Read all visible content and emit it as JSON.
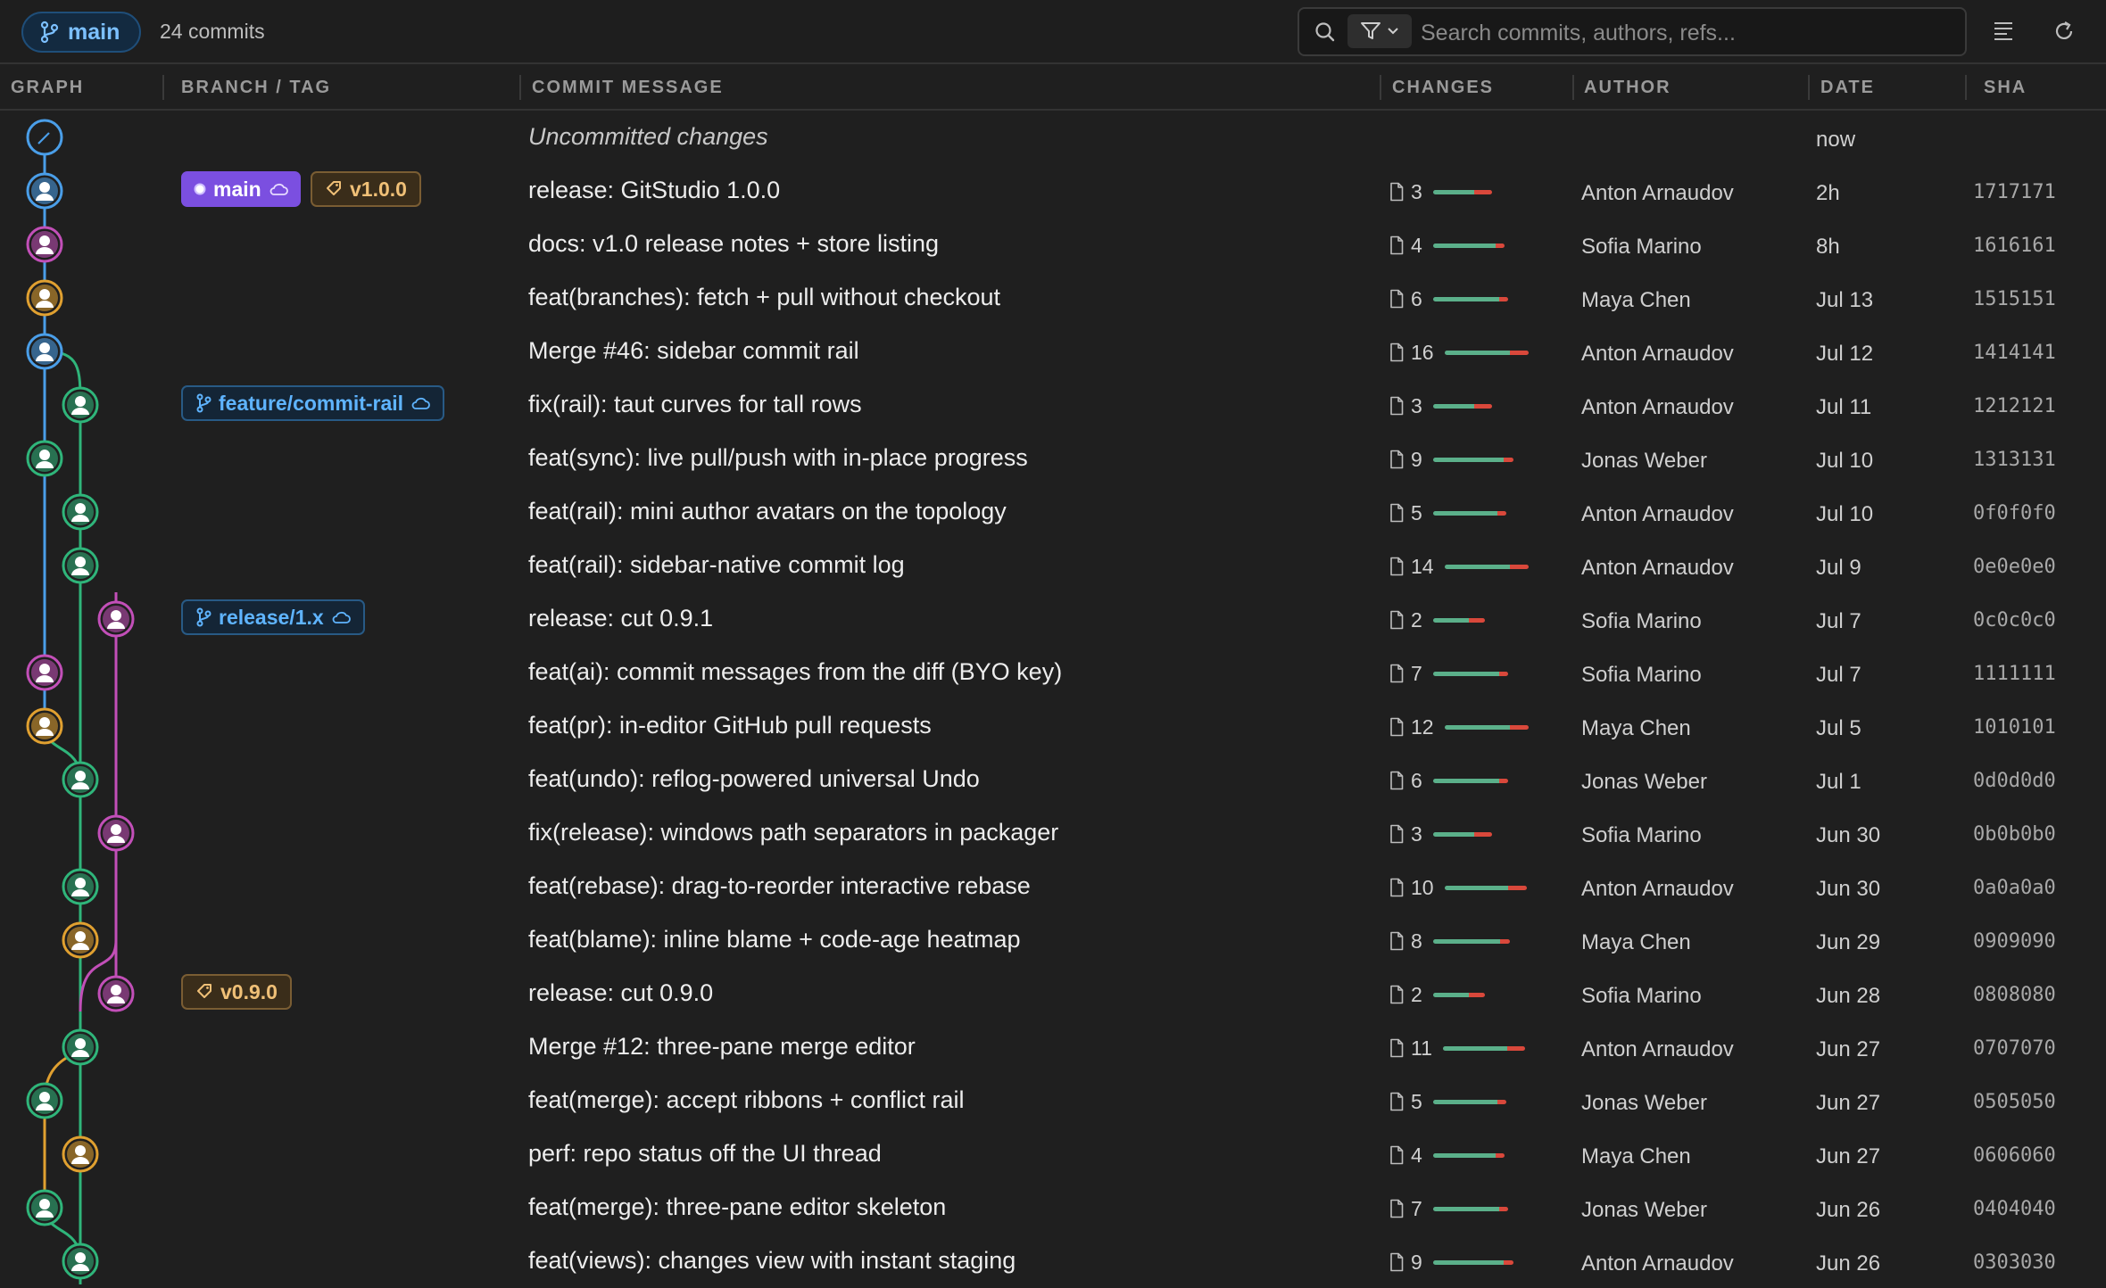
{
  "toolbar": {
    "branch": "main",
    "commit_count": "24 commits",
    "search_placeholder": "Search commits, authors, refs..."
  },
  "columns": {
    "graph": "GRAPH",
    "refs": "BRANCH / TAG",
    "message": "COMMIT MESSAGE",
    "changes": "CHANGES",
    "author": "AUTHOR",
    "date": "DATE",
    "sha": "SHA"
  },
  "colors": {
    "lane_main": "#4a9ee8",
    "lane_feature": "#2fb57a",
    "lane_release": "#c24fb8",
    "lane_merge": "#e0a030",
    "head_badge": "#7b4fe0",
    "bar_add": "#5bb08a",
    "bar_del": "#d9483b"
  },
  "commits": [
    {
      "message": "Uncommitted changes",
      "uncommitted": true,
      "changes": "",
      "author": "",
      "date": "now",
      "sha": ""
    },
    {
      "message": "release: GitStudio 1.0.0",
      "changes": "3",
      "author": "Anton Arnaudov",
      "date": "2h",
      "sha": "1717171",
      "refs": [
        {
          "type": "head",
          "label": "main"
        },
        {
          "type": "tag",
          "label": "v1.0.0"
        }
      ]
    },
    {
      "message": "docs: v1.0 release notes + store listing",
      "changes": "4",
      "author": "Sofia Marino",
      "date": "8h",
      "sha": "1616161"
    },
    {
      "message": "feat(branches): fetch + pull without checkout",
      "changes": "6",
      "author": "Maya Chen",
      "date": "Jul 13",
      "sha": "1515151"
    },
    {
      "message": "Merge #46: sidebar commit rail",
      "changes": "16",
      "author": "Anton Arnaudov",
      "date": "Jul 12",
      "sha": "1414141"
    },
    {
      "message": "fix(rail): taut curves for tall rows",
      "changes": "3",
      "author": "Anton Arnaudov",
      "date": "Jul 11",
      "sha": "1212121",
      "refs": [
        {
          "type": "branch",
          "label": "feature/commit-rail"
        }
      ]
    },
    {
      "message": "feat(sync): live pull/push with in-place progress",
      "changes": "9",
      "author": "Jonas Weber",
      "date": "Jul 10",
      "sha": "1313131"
    },
    {
      "message": "feat(rail): mini author avatars on the topology",
      "changes": "5",
      "author": "Anton Arnaudov",
      "date": "Jul 10",
      "sha": "0f0f0f0"
    },
    {
      "message": "feat(rail): sidebar-native commit log",
      "changes": "14",
      "author": "Anton Arnaudov",
      "date": "Jul 9",
      "sha": "0e0e0e0"
    },
    {
      "message": "release: cut 0.9.1",
      "changes": "2",
      "author": "Sofia Marino",
      "date": "Jul 7",
      "sha": "0c0c0c0",
      "refs": [
        {
          "type": "branch",
          "label": "release/1.x"
        }
      ]
    },
    {
      "message": "feat(ai): commit messages from the diff (BYO key)",
      "changes": "7",
      "author": "Sofia Marino",
      "date": "Jul 7",
      "sha": "1111111"
    },
    {
      "message": "feat(pr): in-editor GitHub pull requests",
      "changes": "12",
      "author": "Maya Chen",
      "date": "Jul 5",
      "sha": "1010101"
    },
    {
      "message": "feat(undo): reflog-powered universal Undo",
      "changes": "6",
      "author": "Jonas Weber",
      "date": "Jul 1",
      "sha": "0d0d0d0"
    },
    {
      "message": "fix(release): windows path separators in packager",
      "changes": "3",
      "author": "Sofia Marino",
      "date": "Jun 30",
      "sha": "0b0b0b0"
    },
    {
      "message": "feat(rebase): drag-to-reorder interactive rebase",
      "changes": "10",
      "author": "Anton Arnaudov",
      "date": "Jun 30",
      "sha": "0a0a0a0"
    },
    {
      "message": "feat(blame): inline blame + code-age heatmap",
      "changes": "8",
      "author": "Maya Chen",
      "date": "Jun 29",
      "sha": "0909090"
    },
    {
      "message": "release: cut 0.9.0",
      "changes": "2",
      "author": "Sofia Marino",
      "date": "Jun 28",
      "sha": "0808080",
      "refs": [
        {
          "type": "tag",
          "label": "v0.9.0"
        }
      ]
    },
    {
      "message": "Merge #12: three-pane merge editor",
      "changes": "11",
      "author": "Anton Arnaudov",
      "date": "Jun 27",
      "sha": "0707070"
    },
    {
      "message": "feat(merge): accept ribbons + conflict rail",
      "changes": "5",
      "author": "Jonas Weber",
      "date": "Jun 27",
      "sha": "0505050"
    },
    {
      "message": "perf: repo status off the UI thread",
      "changes": "4",
      "author": "Maya Chen",
      "date": "Jun 27",
      "sha": "0606060"
    },
    {
      "message": "feat(merge): three-pane editor skeleton",
      "changes": "7",
      "author": "Jonas Weber",
      "date": "Jun 26",
      "sha": "0404040"
    },
    {
      "message": "feat(views): changes view with instant staging",
      "changes": "9",
      "author": "Anton Arnaudov",
      "date": "Jun 26",
      "sha": "0303030"
    }
  ]
}
